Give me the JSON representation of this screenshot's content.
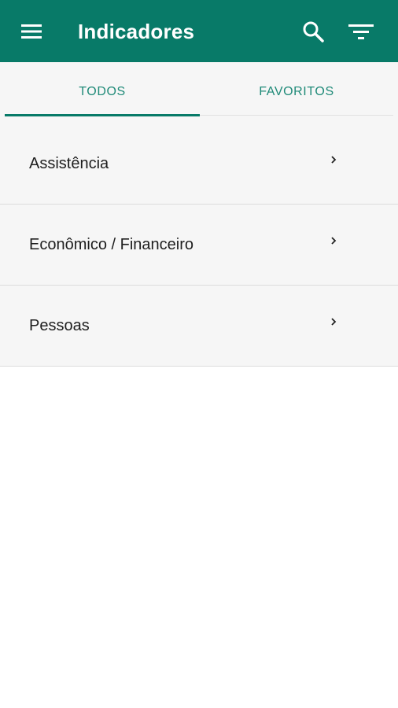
{
  "app_bar": {
    "title": "Indicadores",
    "menu_icon": "hamburger-menu-icon",
    "search_icon": "search-icon",
    "filter_icon": "filter-icon",
    "background_color": "#087a68"
  },
  "tabs": [
    {
      "label": "TODOS",
      "selected": true
    },
    {
      "label": "FAVORITOS",
      "selected": false
    }
  ],
  "list": {
    "items": [
      {
        "label": "Assistência",
        "icon": "chevron-right-icon"
      },
      {
        "label": "Econômico / Financeiro",
        "icon": "chevron-right-icon"
      },
      {
        "label": "Pessoas",
        "icon": "chevron-right-icon"
      }
    ]
  }
}
